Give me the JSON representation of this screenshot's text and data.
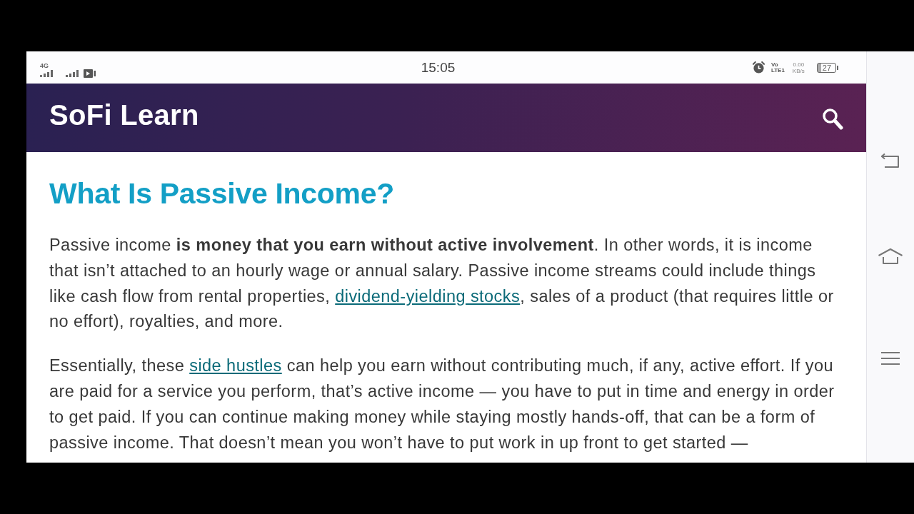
{
  "status_bar": {
    "network": "4G",
    "time": "15:05",
    "volte": [
      "Vo",
      "LTE1"
    ],
    "speed": "0.00",
    "speed_unit": "KB/s",
    "battery": "27"
  },
  "header": {
    "logo": "SoFi Learn"
  },
  "article": {
    "title": "What Is Passive Income?",
    "paragraphs": [
      [
        {
          "kind": "text",
          "text": "Passive income **is money that you earn without active involvement**. In other words, it is income that isn’t attached to an hourly wage or annual salary. Passive income streams could include things like cash flow from rental properties, "
        },
        {
          "kind": "link",
          "text": "dividend-yielding stocks"
        },
        {
          "kind": "text",
          "text": ", sales of a product (that requires little or no effort), royalties, and more."
        }
      ],
      [
        {
          "kind": "text",
          "text": "Essentially, these "
        },
        {
          "kind": "link",
          "text": "side hustles"
        },
        {
          "kind": "text",
          "text": " can help you earn without contributing much, if any, active effort. If you are paid for a service you perform, that’s active income — you have to put in time and energy in order to get paid. If you can continue making money while staying mostly hands-off, that can be a form of passive income. That doesn’t mean you won’t have to put work in up front to get started —"
        }
      ]
    ]
  }
}
